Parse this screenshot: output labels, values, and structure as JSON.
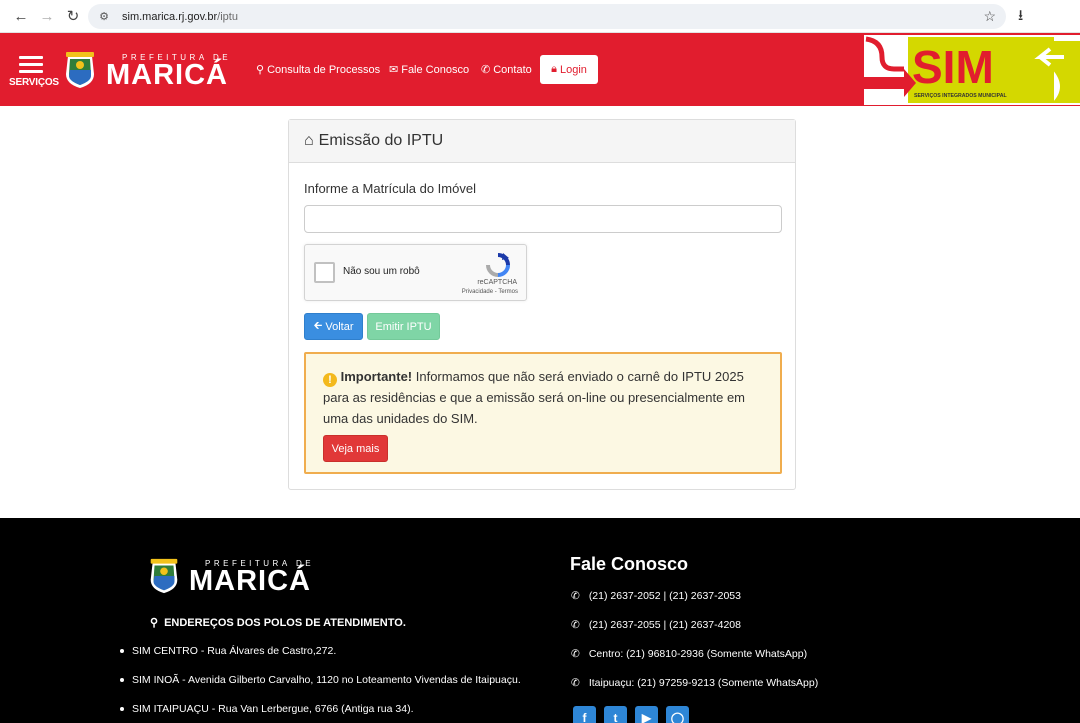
{
  "browser": {
    "url_host": "sim.marica.rj.gov.br",
    "url_path": "/iptu"
  },
  "header": {
    "menu_label": "SERVIÇOS",
    "logo_prefix": "PREFEITURA DE",
    "logo_city": "MARICÁ",
    "nav": {
      "processes": "Consulta de Processos",
      "fale": "Fale Conosco",
      "contact": "Contato",
      "login": "Login"
    },
    "sim_banner": {
      "title": "SIM",
      "subtitle": "SERVIÇOS INTEGRADOS MUNICIPAL"
    },
    "colors": {
      "brand_red": "#e11d2e",
      "sim_yellow": "#d4d800"
    }
  },
  "panel": {
    "title": "Emissão do IPTU",
    "field_label": "Informe a Matrícula do Imóvel",
    "field_value": "",
    "captcha": {
      "label": "Não sou um robô",
      "brand": "reCAPTCHA",
      "privacy": "Privacidade - Termos"
    },
    "buttons": {
      "back": "Voltar",
      "emit": "Emitir IPTU"
    },
    "alert": {
      "strong": "Importante!",
      "text": "Informamos que não será enviado o carnê do IPTU 2025 para as residências e que a emissão será on-line ou presencialmente em uma das unidades do SIM.",
      "more": "Veja mais"
    }
  },
  "footer": {
    "logo_prefix": "PREFEITURA DE",
    "logo_city": "MARICÁ",
    "addresses_title": "ENDEREÇOS DOS POLOS DE ATENDIMENTO.",
    "addresses": [
      "SIM CENTRO - Rua Álvares de Castro,272.",
      "SIM INOÃ - Avenida Gilberto Carvalho, 1120 no Loteamento Vivendas de Itaipuaçu.",
      "SIM ITAIPUAÇU - Rua Van Lerbergue, 6766 (Antiga rua 34)."
    ],
    "contact_title": "Fale Conosco",
    "phones": [
      "(21) 2637-2052 | (21) 2637-2053",
      "(21) 2637-2055 | (21) 2637-4208",
      "Centro: (21) 96810-2936 (Somente WhatsApp)",
      "Itaipuaçu: (21) 97259-9213 (Somente WhatsApp)"
    ],
    "social_icons": [
      "facebook-icon",
      "twitter-icon",
      "youtube-icon",
      "instagram-icon"
    ]
  }
}
